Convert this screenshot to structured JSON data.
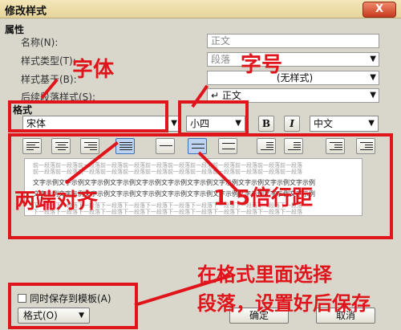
{
  "window": {
    "title": "修改样式",
    "close_label": "X"
  },
  "properties": {
    "heading": "属性",
    "name_label": "名称(N):",
    "name_value": "正文",
    "type_label": "样式类型(T):",
    "type_value": "段落",
    "based_label": "样式基于(B):",
    "based_value": "(无样式)",
    "next_label": "后续段落样式(S):",
    "next_value": "↵ 正文"
  },
  "format": {
    "heading": "格式",
    "font_value": "宋体",
    "size_value": "小四",
    "bold_label": "B",
    "italic_label": "I",
    "lang_value": "中文"
  },
  "preview": {
    "prev_text": "前一段落前一段落前一段落前一段落前一段落前一段落前一段落前一段落前一段落前一段落前一段落前一段落",
    "sample_text": "文字示例文字示例文字示例文字示例文字示例文字示例文字示例文字示例文字示例文字示例文字示例",
    "next_text": "下一段落下一段落下一段落下一段落下一段落下一段落下一段落下一段落下一段落下一段落下一段落下一段落"
  },
  "bottom": {
    "save_to_template_label": "同时保存到模板(A)",
    "format_button_label": "格式(O)",
    "ok_label": "确定",
    "cancel_label": "取消"
  },
  "annotations": {
    "font": "字体",
    "size": "字号",
    "justify": "两端对齐",
    "spacing": "1.5倍行距",
    "instruction_line1": "在格式里面选择",
    "instruction_line2": "段落，设置好后保存"
  },
  "colors": {
    "annotation": "#e0151c",
    "titlebar": "#f3e6b9",
    "dialog": "#d9d6cc"
  }
}
